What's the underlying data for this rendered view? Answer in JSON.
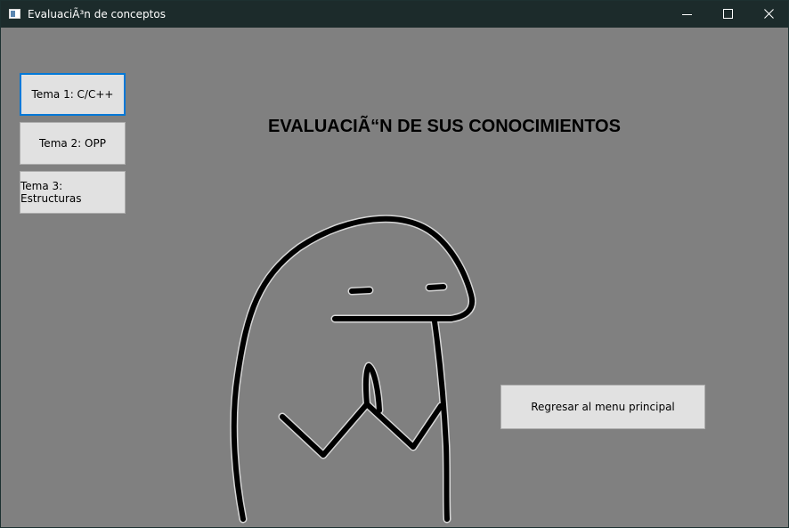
{
  "window": {
    "title": "EvaluaciÃ³n de conceptos"
  },
  "sidebar": {
    "buttons": [
      {
        "label": "Tema 1: C/C++"
      },
      {
        "label": "Tema 2: OPP"
      },
      {
        "label": "Tema 3: Estructuras"
      }
    ]
  },
  "main": {
    "heading": "EVALUACIÃ“N DE SUS CONOCIMIENTOS",
    "back_button": "Regresar al menu principal"
  },
  "icons": {
    "app": "app-window-icon",
    "minimize": "minimize-icon",
    "maximize": "maximize-icon",
    "close": "close-icon"
  },
  "colors": {
    "titlebar": "#1c2b2b",
    "background": "#808080",
    "button": "#e1e1e1",
    "focus": "#0078d7"
  }
}
